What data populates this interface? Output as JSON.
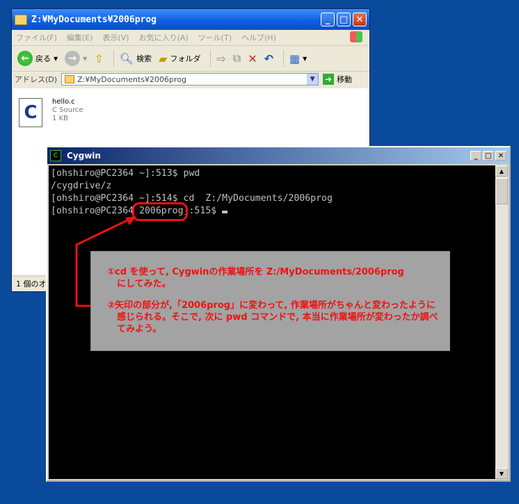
{
  "explorer": {
    "title": "Z:¥MyDocuments¥2006prog",
    "menu": [
      "ファイル(F)",
      "編集(E)",
      "表示(V)",
      "お気に入り(A)",
      "ツール(T)",
      "ヘルプ(H)"
    ],
    "toolbar": {
      "back": "戻る",
      "search": "検索",
      "folders": "フォルダ"
    },
    "address_label": "アドレス(D)",
    "address": "Z:¥MyDocuments¥2006prog",
    "go": "移動",
    "file": {
      "name": "hello.c",
      "type": "C Source",
      "size": "1 KB"
    },
    "status": "1 個のオ"
  },
  "cygwin": {
    "title": "Cygwin",
    "lines": [
      "[ohshiro@PC2364 ~]:513$ pwd",
      "/cygdrive/z",
      "[ohshiro@PC2364 ~]:514$ cd  Z:/MyDocuments/2006prog",
      "[ohshiro@PC2364 2006prog]:515$ "
    ]
  },
  "annotation": {
    "line1": "①cd を使って, Cygwinの作業場所を Z:/MyDocuments/2006prog",
    "line2": "にしてみた。",
    "line3": "②矢印の部分が,「2006prog」に変わって, 作業場所がちゃんと変わったように",
    "line4": "感じられる。そこで, 次に pwd コマンドで, 本当に作業場所が変わったか調べ",
    "line5": "てみよう。"
  },
  "colors": {
    "desktop": "#0a4a9a",
    "annotation_text": "#ee1111",
    "annotation_bg": "#a3a3a3"
  },
  "icons": [
    "folder-icon",
    "windows-flag-icon",
    "back-icon",
    "forward-icon",
    "up-folder-icon",
    "search-icon",
    "folders-icon",
    "move-icon",
    "copy-icon",
    "delete-icon",
    "undo-icon",
    "views-icon",
    "go-arrow-icon",
    "c-source-file-icon",
    "cygwin-logo-icon"
  ]
}
